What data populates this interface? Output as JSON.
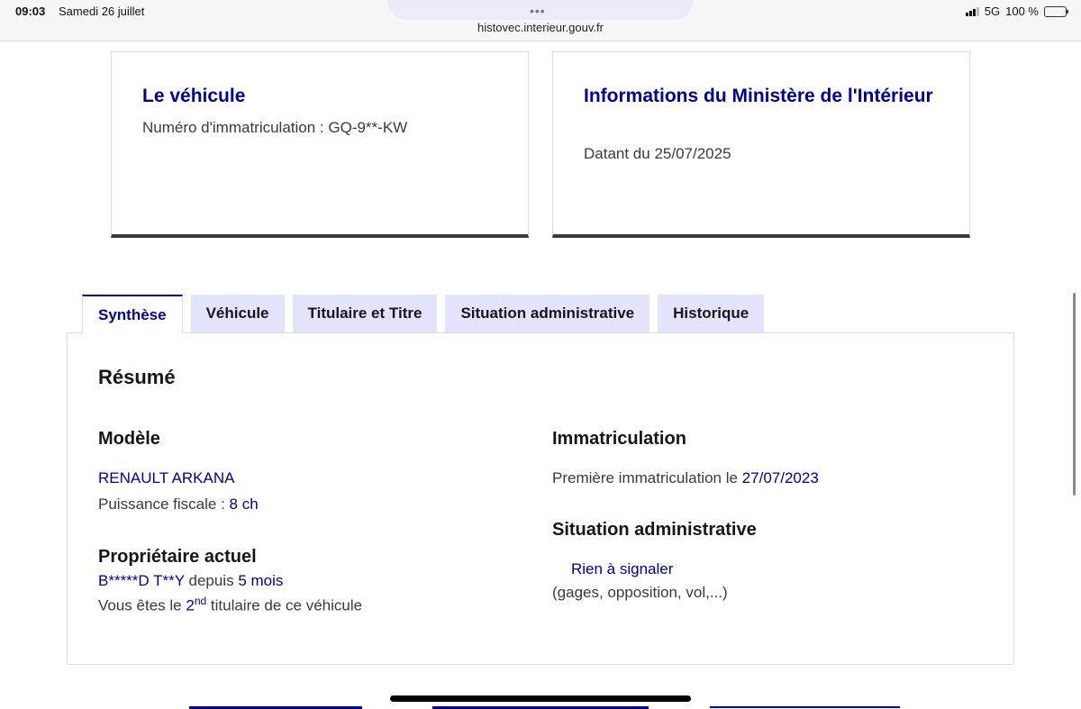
{
  "status_bar": {
    "time": "09:03",
    "date": "Samedi 26 juillet",
    "url": "histovec.interieur.gouv.fr",
    "network": "5G",
    "battery": "100 %",
    "battery_level": 1.0
  },
  "cards": {
    "vehicle": {
      "title": "Le véhicule",
      "plate_label": "Numéro d'immatriculation : ",
      "plate_value": "GQ-9**-KW"
    },
    "ministry": {
      "title": "Informations du Ministère de l'Intérieur",
      "date_text": "Datant du 25/07/2025"
    }
  },
  "tabs": [
    {
      "label": "Synthèse",
      "active": true
    },
    {
      "label": "Véhicule",
      "active": false
    },
    {
      "label": "Titulaire et Titre",
      "active": false
    },
    {
      "label": "Situation administrative",
      "active": false
    },
    {
      "label": "Historique",
      "active": false
    }
  ],
  "summary": {
    "heading": "Résumé",
    "model": {
      "heading": "Modèle",
      "name": "RENAULT ARKANA",
      "fiscal_label": "Puissance fiscale : ",
      "fiscal_value": "8 ch"
    },
    "owner": {
      "heading": "Propriétaire actuel",
      "name": "B*****D T**Y",
      "since_label": " depuis ",
      "since_value": "5 mois",
      "rank_prefix": "Vous êtes le ",
      "rank_value": "2",
      "rank_suffix": "nd",
      "rank_tail": " titulaire de ce véhicule"
    },
    "registration": {
      "heading": "Immatriculation",
      "first_label": "Première immatriculation le ",
      "first_value": "27/07/2023"
    },
    "admin": {
      "heading": "Situation administrative",
      "status": "Rien à signaler",
      "detail": "(gages, opposition, vol,...)"
    }
  },
  "colors": {
    "accent": "#000091",
    "tab_bg": "#e3e3fd",
    "text": "#3a3a3a"
  }
}
